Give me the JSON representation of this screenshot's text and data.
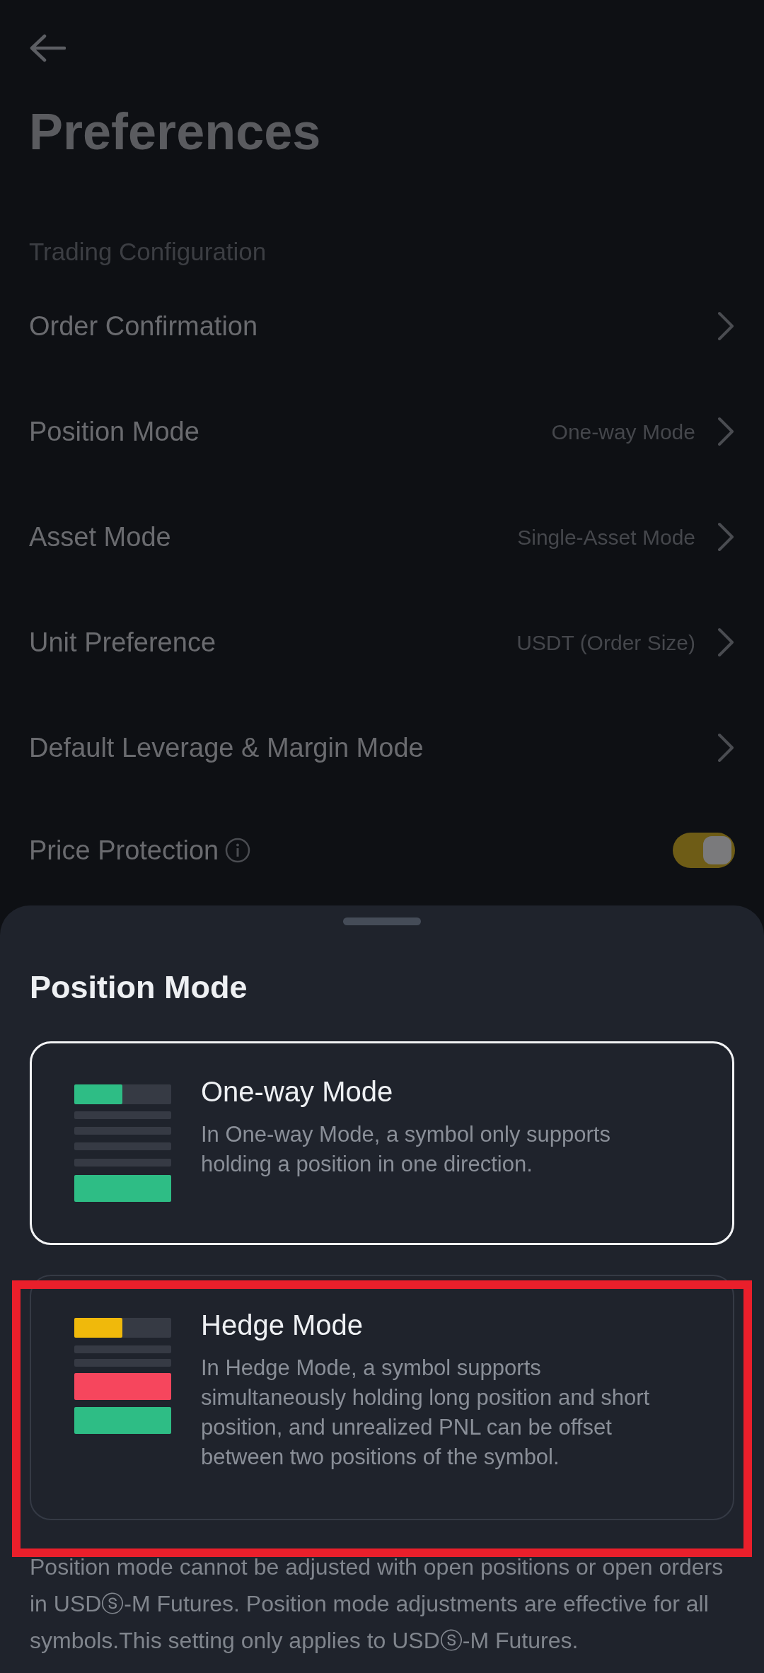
{
  "page": {
    "title": "Preferences",
    "section": "Trading Configuration"
  },
  "settings": [
    {
      "kind": "link",
      "label": "Order Confirmation"
    },
    {
      "kind": "link",
      "label": "Position Mode",
      "value": "One-way Mode"
    },
    {
      "kind": "link",
      "label": "Asset Mode",
      "value": "Single-Asset Mode"
    },
    {
      "kind": "link",
      "label": "Unit Preference",
      "value": "USDT (Order Size)"
    },
    {
      "kind": "link",
      "label": "Default Leverage & Margin Mode"
    },
    {
      "kind": "toggle",
      "label": "Price Protection",
      "info": true,
      "on": true
    }
  ],
  "sheet": {
    "title": "Position Mode",
    "options": [
      {
        "kind": "one-way",
        "title": "One-way Mode",
        "description": "In One-way Mode, a symbol only supports holding a position in one direction.",
        "selected": true,
        "highlighted": false
      },
      {
        "kind": "hedge",
        "title": "Hedge Mode",
        "description": "In Hedge Mode, a symbol supports simultaneously holding long position and short position, and unrealized PNL can be offset between two positions of the symbol.",
        "selected": false,
        "highlighted": true
      }
    ],
    "note": "Position mode cannot be adjusted with open positions or open orders in USDⓢ-M Futures. Position mode adjustments are effective for all symbols.This setting only applies to USDⓢ-M Futures."
  }
}
